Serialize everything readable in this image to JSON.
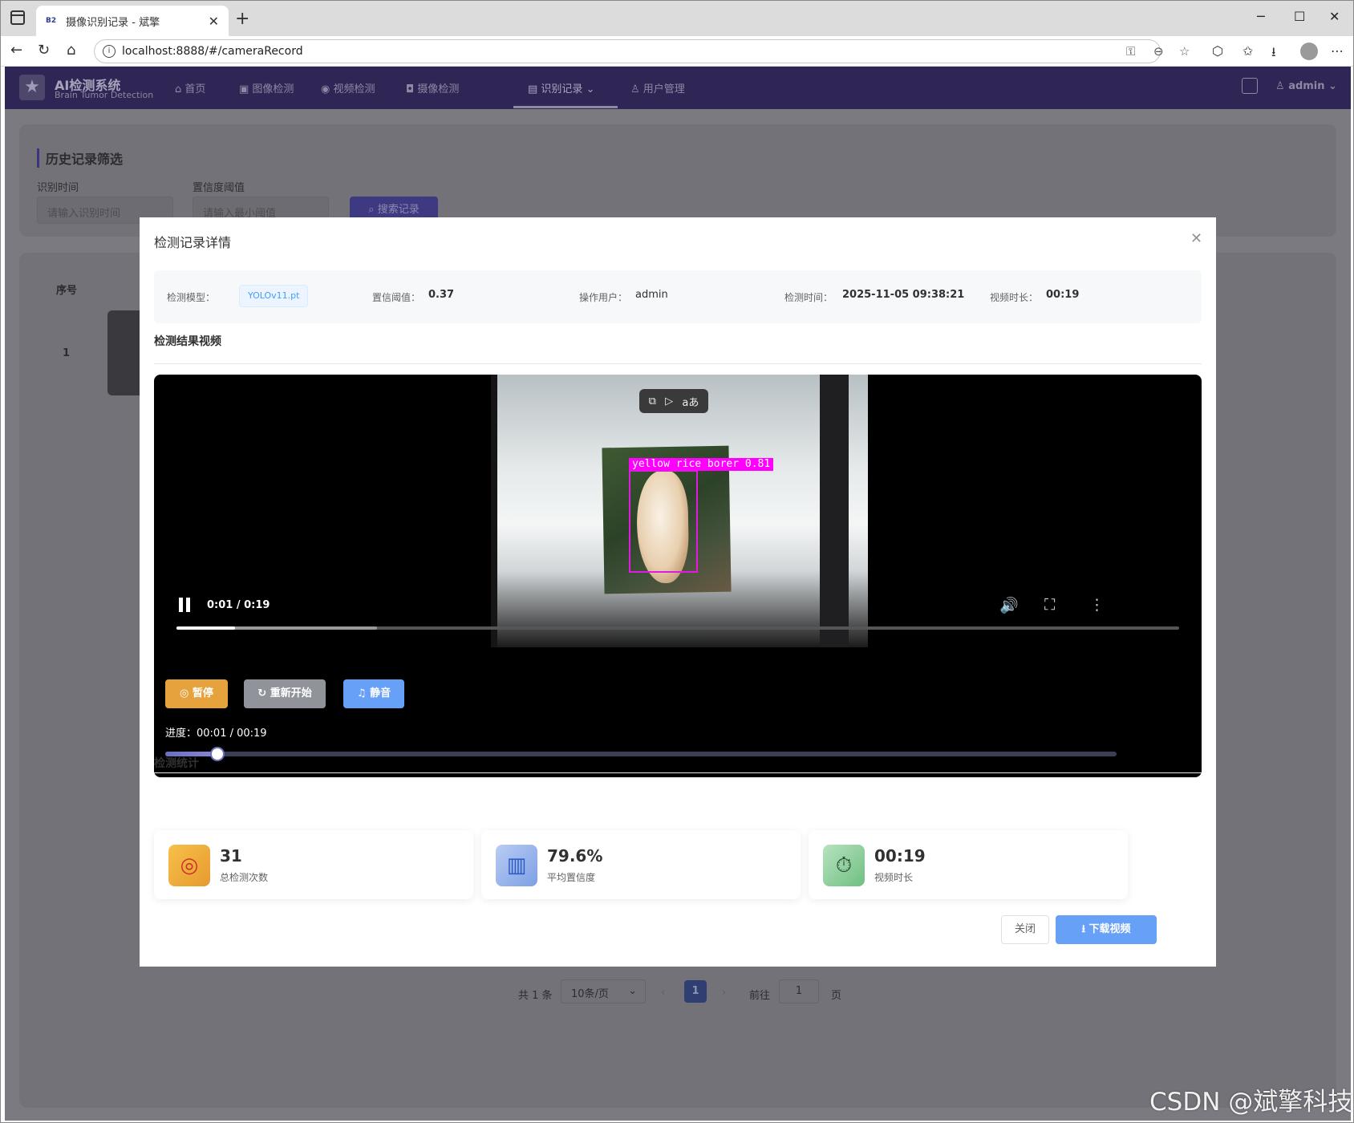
{
  "browser": {
    "tab_title": "摄像识别记录 - 斌擎",
    "tab_favicon": "B2",
    "url": "localhost:8888/#/cameraRecord"
  },
  "topnav": {
    "logo_title": "AI检测系统",
    "logo_subtitle": "Brain Tumor Detection",
    "items": [
      {
        "label": "首页",
        "icon": "home-icon"
      },
      {
        "label": "图像检测",
        "icon": "image-icon"
      },
      {
        "label": "视频检测",
        "icon": "play-circle-icon"
      },
      {
        "label": "摄像检测",
        "icon": "camera-icon"
      },
      {
        "label": "识别记录",
        "icon": "document-icon"
      },
      {
        "label": "用户管理",
        "icon": "user-icon"
      }
    ],
    "user": "admin"
  },
  "filter_panel": {
    "title": "历史记录筛选",
    "time_label": "识别时间",
    "time_placeholder": "请输入识别时间",
    "confidence_label": "置信度阈值",
    "confidence_placeholder": "请输入最小阈值",
    "search_button": "搜索记录"
  },
  "table": {
    "header_seq": "序号",
    "row_seq": "1"
  },
  "pagination": {
    "total": "共 1 条",
    "page_size": "10条/页",
    "current_page": "1",
    "goto_label": "前往",
    "goto_value": "1",
    "page_suffix": "页"
  },
  "dialog": {
    "title": "检测记录详情",
    "info": {
      "model_label": "检测模型：",
      "model_value": "YOLOv11.pt",
      "threshold_label": "置信阈值：",
      "threshold_value": "0.37",
      "user_label": "操作用户：",
      "user_value": "admin",
      "time_label": "检测时间：",
      "time_value": "2025-11-05 09:38:21",
      "duration_label": "视频时长：",
      "duration_value": "00:19"
    },
    "video_section_title": "检测结果视频",
    "video": {
      "detection_label": "yellow rice borer 0.81",
      "time_display": "0:01 / 0:19",
      "played_fraction": 0.058,
      "buffered_fraction": 0.2,
      "pip_translate_glyph": "aあ"
    },
    "controls": {
      "pause": "暂停",
      "restart": "重新开始",
      "mute": "静音",
      "progress_text": "进度：00:01 / 00:19",
      "progress_fraction": 0.055
    },
    "stats_section_title": "检测统计",
    "stats": [
      {
        "value": "31",
        "label": "总检测次数",
        "icon": "target-icon"
      },
      {
        "value": "79.6%",
        "label": "平均置信度",
        "icon": "bar-chart-icon"
      },
      {
        "value": "00:19",
        "label": "视频时长",
        "icon": "stopwatch-icon"
      }
    ],
    "close_button": "关闭",
    "download_button": "下载视频"
  },
  "watermark": "CSDN @斌擎科技"
}
